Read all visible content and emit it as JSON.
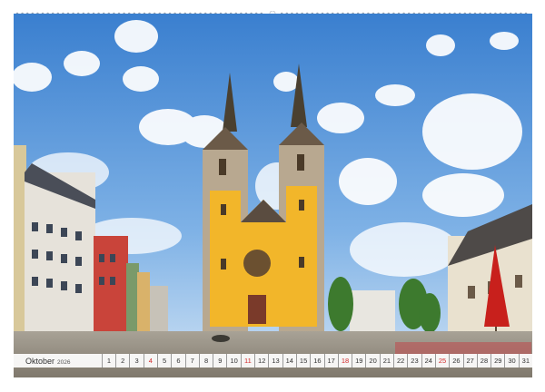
{
  "calendar": {
    "month": "Oktober",
    "year": "2026",
    "days": [
      {
        "n": "1",
        "sunday": false
      },
      {
        "n": "2",
        "sunday": false
      },
      {
        "n": "3",
        "sunday": false
      },
      {
        "n": "4",
        "sunday": true
      },
      {
        "n": "5",
        "sunday": false
      },
      {
        "n": "6",
        "sunday": false
      },
      {
        "n": "7",
        "sunday": false
      },
      {
        "n": "8",
        "sunday": false
      },
      {
        "n": "9",
        "sunday": false
      },
      {
        "n": "10",
        "sunday": false
      },
      {
        "n": "11",
        "sunday": true
      },
      {
        "n": "12",
        "sunday": false
      },
      {
        "n": "13",
        "sunday": false
      },
      {
        "n": "14",
        "sunday": false
      },
      {
        "n": "15",
        "sunday": false
      },
      {
        "n": "16",
        "sunday": false
      },
      {
        "n": "17",
        "sunday": false
      },
      {
        "n": "18",
        "sunday": true
      },
      {
        "n": "19",
        "sunday": false
      },
      {
        "n": "20",
        "sunday": false
      },
      {
        "n": "21",
        "sunday": false
      },
      {
        "n": "22",
        "sunday": false
      },
      {
        "n": "23",
        "sunday": false
      },
      {
        "n": "24",
        "sunday": false
      },
      {
        "n": "25",
        "sunday": true
      },
      {
        "n": "26",
        "sunday": false
      },
      {
        "n": "27",
        "sunday": false
      },
      {
        "n": "28",
        "sunday": false
      },
      {
        "n": "29",
        "sunday": false
      },
      {
        "n": "30",
        "sunday": false
      },
      {
        "n": "31",
        "sunday": false
      }
    ]
  },
  "colors": {
    "sky_top": "#3a7fcf",
    "sky_bottom": "#a9cdee",
    "church_facade": "#f2b62a",
    "sunday_red": "#d22a2a"
  }
}
